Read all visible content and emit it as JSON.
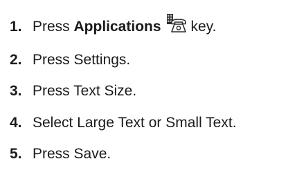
{
  "steps": [
    {
      "num": "1.",
      "prefix": "Press ",
      "key": "Applications",
      "suffix": "key.",
      "icon": "applications-phone-icon"
    },
    {
      "num": "2.",
      "text": "Press Settings."
    },
    {
      "num": "3.",
      "text": "Press Text Size."
    },
    {
      "num": "4.",
      "text": "Select Large Text or Small Text."
    },
    {
      "num": "5.",
      "text": "Press Save."
    }
  ]
}
